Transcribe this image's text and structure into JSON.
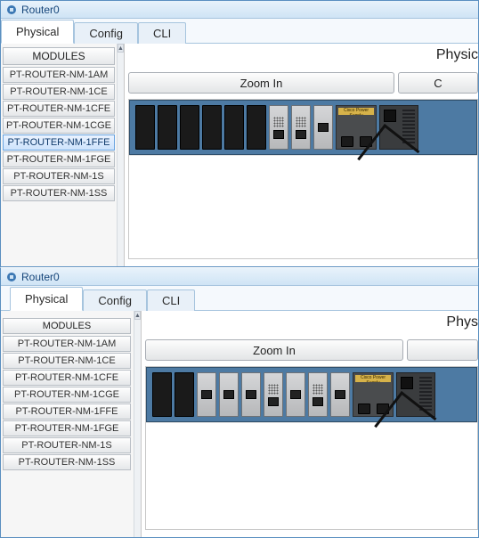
{
  "window1": {
    "title": "Router0",
    "tabs": {
      "physical": "Physical",
      "config": "Config",
      "cli": "CLI"
    },
    "active_tab": "physical",
    "sidebar": {
      "header": "MODULES",
      "items": [
        "PT-ROUTER-NM-1AM",
        "PT-ROUTER-NM-1CE",
        "PT-ROUTER-NM-1CFE",
        "PT-ROUTER-NM-1CGE",
        "PT-ROUTER-NM-1FFE",
        "PT-ROUTER-NM-1FGE",
        "PT-ROUTER-NM-1S",
        "PT-ROUTER-NM-1SS"
      ],
      "selected_index": 4
    },
    "main": {
      "section_title_partial": "Physic",
      "zoom_in": "Zoom In",
      "other_btn_partial": "C",
      "psu_label": "Cisco Power Supply"
    },
    "device": {
      "empty_slots": 6,
      "installed_modules": 3
    }
  },
  "window2": {
    "title": "Router0",
    "tabs": {
      "physical": "Physical",
      "config": "Config",
      "cli": "CLI"
    },
    "active_tab": "physical",
    "sidebar": {
      "header": "MODULES",
      "items": [
        "PT-ROUTER-NM-1AM",
        "PT-ROUTER-NM-1CE",
        "PT-ROUTER-NM-1CFE",
        "PT-ROUTER-NM-1CGE",
        "PT-ROUTER-NM-1FFE",
        "PT-ROUTER-NM-1FGE",
        "PT-ROUTER-NM-1S",
        "PT-ROUTER-NM-1SS"
      ],
      "selected_index": -1
    },
    "main": {
      "section_title_partial": "Phys",
      "zoom_in": "Zoom In",
      "other_btn_partial": "",
      "psu_label": "Cisco Power Supply"
    },
    "device": {
      "empty_slots": 2,
      "installed_modules": 7
    }
  }
}
